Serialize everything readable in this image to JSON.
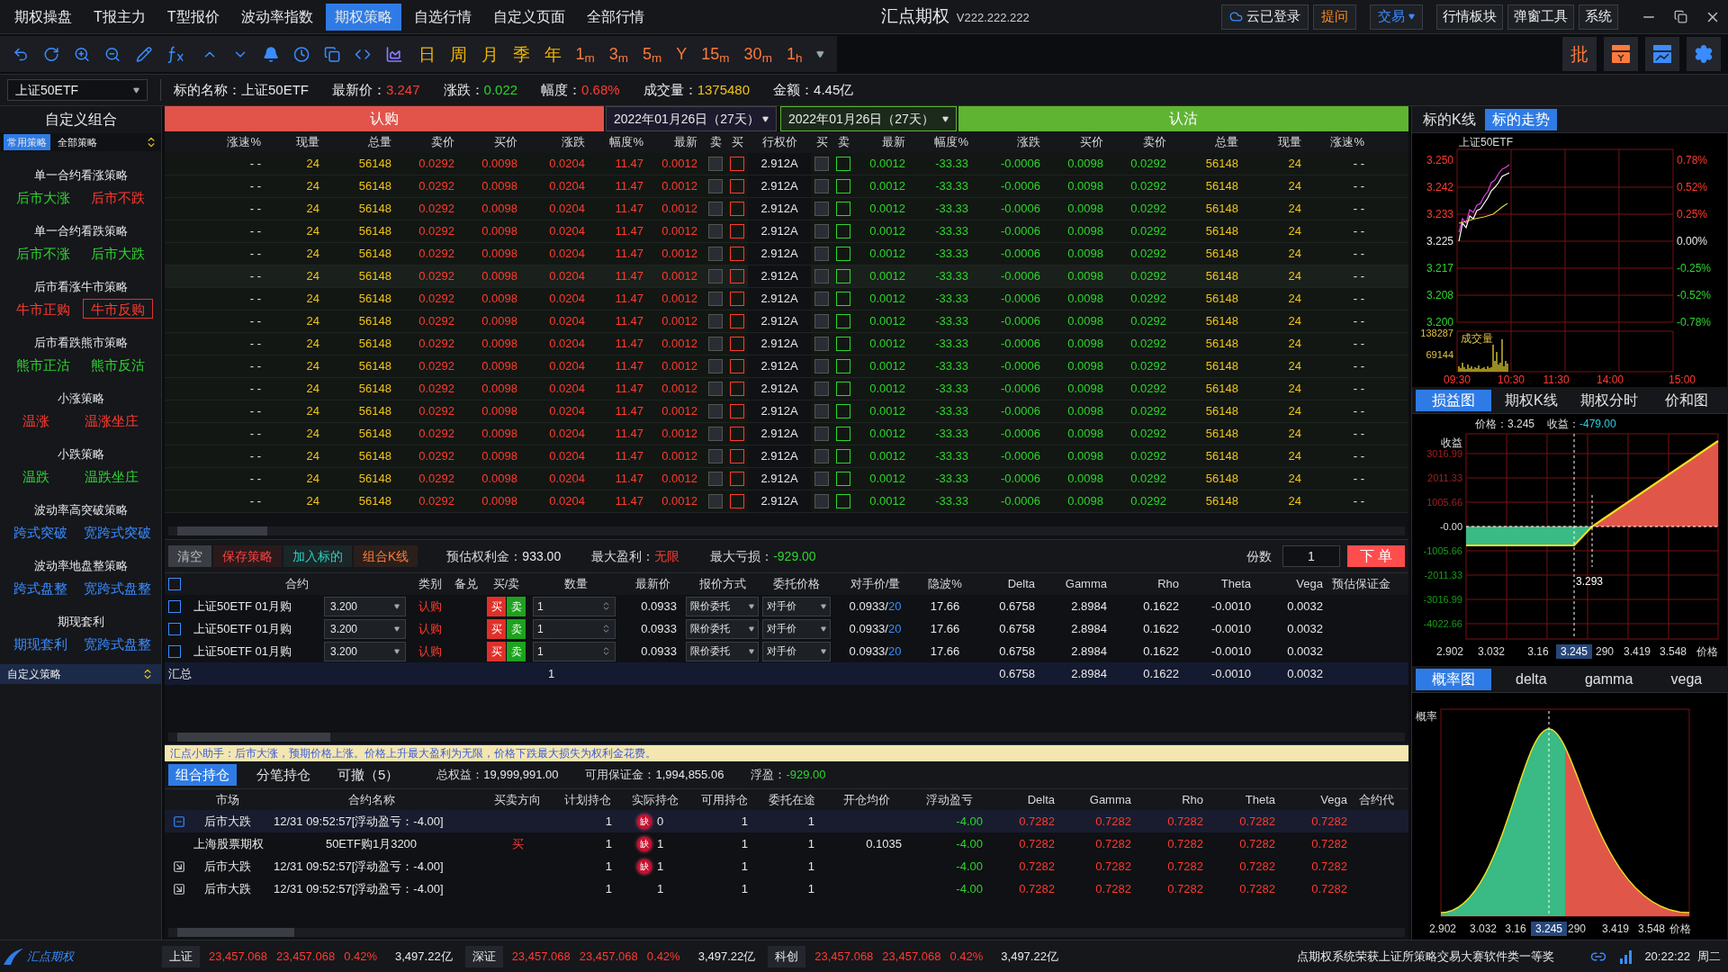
{
  "menu": {
    "tabs": [
      {
        "label": "期权操盘",
        "selected": false
      },
      {
        "label": "T报主力",
        "selected": false
      },
      {
        "label": "T型报价",
        "selected": false
      },
      {
        "label": "波动率指数",
        "selected": false
      },
      {
        "label": "期权策略",
        "selected": true
      },
      {
        "label": "自选行情",
        "selected": false
      },
      {
        "label": "自定义页面",
        "selected": false
      },
      {
        "label": "全部行情",
        "selected": false
      }
    ],
    "title": "汇点期权",
    "version": "V222.222.222",
    "buttons": [
      {
        "label": "云已登录",
        "kind": "cloud"
      },
      {
        "label": "提问",
        "kind": "ask"
      },
      {
        "label": "交易",
        "kind": "dropdown"
      },
      {
        "label": "行情板块",
        "kind": "plain"
      },
      {
        "label": "弹窗工具",
        "kind": "plain"
      },
      {
        "label": "系统",
        "kind": "plain"
      }
    ]
  },
  "toolbar": {
    "periods": [
      {
        "label": "日",
        "kind": "day"
      },
      {
        "label": "周",
        "kind": "day"
      },
      {
        "label": "月",
        "kind": "day"
      },
      {
        "label": "季",
        "kind": "day"
      },
      {
        "label": "年",
        "kind": "day"
      },
      {
        "label": "1$_{m}$",
        "kind": "minute"
      },
      {
        "label": "3$_{m}$",
        "kind": "minute"
      },
      {
        "label": "5$_{m}$",
        "kind": "minute"
      },
      {
        "label": "Y",
        "kind": "minute"
      },
      {
        "label": "15$_{m}$",
        "kind": "minute"
      },
      {
        "label": "30$_{m}$",
        "kind": "minute"
      },
      {
        "label": "1$_{h}$",
        "kind": "minute"
      }
    ],
    "batch": "批"
  },
  "info": {
    "symbol": "上证50ETF",
    "fields": [
      {
        "label": "标的名称：",
        "value": "上证50ETF",
        "color": "#e8e8e8"
      },
      {
        "label": "最新价：",
        "value": "3.247",
        "color": "#ff3b30"
      },
      {
        "label": "涨跌：",
        "value": "0.022",
        "color": "#2ed52e"
      },
      {
        "label": "幅度：",
        "value": "0.68%",
        "color": "#ff3b30"
      },
      {
        "label": "成交量：",
        "value": "1375480",
        "color": "#f0c419"
      },
      {
        "label": "金额：",
        "value": "4.45亿",
        "color": "#e8e8e8"
      }
    ]
  },
  "sidebar": {
    "title": "自定义组合",
    "tabs": [
      {
        "label": "常用策略",
        "selected": true
      },
      {
        "label": "全部策略",
        "selected": false
      }
    ],
    "groups": [
      {
        "title": "单一合约看涨策略",
        "items": [
          {
            "label": "后市大涨",
            "color": "#2ed52e",
            "selected": false
          },
          {
            "label": "后市不跌",
            "color": "#ff3b30",
            "selected": false
          }
        ]
      },
      {
        "title": "单一合约看跌策略",
        "items": [
          {
            "label": "后市不涨",
            "color": "#2ed52e",
            "selected": false
          },
          {
            "label": "后市大跌",
            "color": "#2ed52e",
            "selected": false
          }
        ]
      },
      {
        "title": "后市看涨牛市策略",
        "items": [
          {
            "label": "牛市正购",
            "color": "#ff3b30",
            "selected": false
          },
          {
            "label": "牛市反购",
            "color": "#ff3b30",
            "selected": true
          }
        ]
      },
      {
        "title": "后市看跌熊市策略",
        "items": [
          {
            "label": "熊市正沽",
            "color": "#2ed52e",
            "selected": false
          },
          {
            "label": "熊市反沽",
            "color": "#2ed52e",
            "selected": false
          }
        ]
      },
      {
        "title": "小涨策略",
        "items": [
          {
            "label": "温涨",
            "color": "#ff3b30",
            "selected": false
          },
          {
            "label": "温涨坐庄",
            "color": "#ff3b30",
            "selected": false
          }
        ]
      },
      {
        "title": "小跌策略",
        "items": [
          {
            "label": "温跌",
            "color": "#2ed52e",
            "selected": false
          },
          {
            "label": "温跌坐庄",
            "color": "#2ed52e",
            "selected": false
          }
        ]
      },
      {
        "title": "波动率高突破策略",
        "items": [
          {
            "label": "跨式突破",
            "color": "#3b8cff",
            "selected": false
          },
          {
            "label": "宽跨式突破",
            "color": "#3b8cff",
            "selected": false
          }
        ]
      },
      {
        "title": "波动率地盘整策略",
        "items": [
          {
            "label": "跨式盘整",
            "color": "#3b8cff",
            "selected": false
          },
          {
            "label": "宽跨式盘整",
            "color": "#3b8cff",
            "selected": false
          }
        ]
      },
      {
        "title": "期现套利",
        "items": [
          {
            "label": "期现套利",
            "color": "#3b8cff",
            "selected": false
          },
          {
            "label": "宽跨式盘整",
            "color": "#3b8cff",
            "selected": false
          }
        ]
      }
    ],
    "custom": "自定义策略"
  },
  "chain": {
    "call_label": "认购",
    "put_label": "认沽",
    "call_date": "2022年01月26日（27天）",
    "put_date": "2022年01月26日（27天）",
    "columns": [
      "涨速%",
      "现量",
      "总量",
      "卖价",
      "买价",
      "涨跌",
      "幅度%",
      "最新",
      "卖",
      "买",
      "行权价",
      "买",
      "卖",
      "最新",
      "幅度%",
      "涨跌",
      "买价",
      "卖价",
      "总量",
      "现量",
      "涨速%"
    ],
    "rows": [
      {
        "call": [
          "- -",
          "24",
          "56148",
          "0.0292",
          "0.0098",
          "0.0204",
          "11.47",
          "0.0012"
        ],
        "call_sell_checked": false,
        "call_buy_checked": false,
        "strike": "2.912A",
        "put_buy_checked": false,
        "put_sell_checked": false,
        "put": [
          "0.0012",
          "-33.33",
          "-0.0006",
          "0.0098",
          "0.0292",
          "56148",
          "24",
          "- -"
        ]
      },
      {
        "call": [
          "- -",
          "24",
          "56148",
          "0.0292",
          "0.0098",
          "0.0204",
          "11.47",
          "0.0012"
        ],
        "call_sell_checked": false,
        "call_buy_checked": false,
        "strike": "2.912A",
        "put_buy_checked": false,
        "put_sell_checked": false,
        "put": [
          "0.0012",
          "-33.33",
          "-0.0006",
          "0.0098",
          "0.0292",
          "56148",
          "24",
          "- -"
        ]
      },
      {
        "call": [
          "- -",
          "24",
          "56148",
          "0.0292",
          "0.0098",
          "0.0204",
          "11.47",
          "0.0012"
        ],
        "call_sell_checked": false,
        "call_buy_checked": false,
        "strike": "2.912A",
        "put_buy_checked": false,
        "put_sell_checked": false,
        "put": [
          "0.0012",
          "-33.33",
          "-0.0006",
          "0.0098",
          "0.0292",
          "56148",
          "24",
          "- -"
        ]
      },
      {
        "call": [
          "- -",
          "24",
          "56148",
          "0.0292",
          "0.0098",
          "0.0204",
          "11.47",
          "0.0012"
        ],
        "call_sell_checked": false,
        "call_buy_checked": false,
        "strike": "2.912A",
        "put_buy_checked": false,
        "put_sell_checked": false,
        "put": [
          "0.0012",
          "-33.33",
          "-0.0006",
          "0.0098",
          "0.0292",
          "56148",
          "24",
          "- -"
        ]
      },
      {
        "call": [
          "- -",
          "24",
          "56148",
          "0.0292",
          "0.0098",
          "0.0204",
          "11.47",
          "0.0012"
        ],
        "call_sell_checked": false,
        "call_buy_checked": false,
        "strike": "2.912A",
        "put_buy_checked": false,
        "put_sell_checked": false,
        "put": [
          "0.0012",
          "-33.33",
          "-0.0006",
          "0.0098",
          "0.0292",
          "56148",
          "24",
          "- -"
        ]
      },
      {
        "call": [
          "- -",
          "24",
          "56148",
          "0.0292",
          "0.0098",
          "0.0204",
          "11.47",
          "0.0012"
        ],
        "call_sell_checked": false,
        "call_buy_checked": false,
        "strike": "2.912A",
        "put_buy_checked": false,
        "put_sell_checked": false,
        "put": [
          "0.0012",
          "-33.33",
          "-0.0006",
          "0.0098",
          "0.0292",
          "56148",
          "24",
          "- -"
        ]
      },
      {
        "call": [
          "- -",
          "24",
          "56148",
          "0.0292",
          "0.0098",
          "0.0204",
          "11.47",
          "0.0012"
        ],
        "call_sell_checked": false,
        "call_buy_checked": false,
        "strike": "2.912A",
        "put_buy_checked": false,
        "put_sell_checked": false,
        "put": [
          "0.0012",
          "-33.33",
          "-0.0006",
          "0.0098",
          "0.0292",
          "56148",
          "24",
          "- -"
        ]
      },
      {
        "call": [
          "- -",
          "24",
          "56148",
          "0.0292",
          "0.0098",
          "0.0204",
          "11.47",
          "0.0012"
        ],
        "call_sell_checked": false,
        "call_buy_checked": false,
        "strike": "2.912A",
        "put_buy_checked": false,
        "put_sell_checked": false,
        "put": [
          "0.0012",
          "-33.33",
          "-0.0006",
          "0.0098",
          "0.0292",
          "56148",
          "24",
          "- -"
        ]
      },
      {
        "call": [
          "- -",
          "24",
          "56148",
          "0.0292",
          "0.0098",
          "0.0204",
          "11.47",
          "0.0012"
        ],
        "call_sell_checked": false,
        "call_buy_checked": false,
        "strike": "2.912A",
        "put_buy_checked": false,
        "put_sell_checked": false,
        "put": [
          "0.0012",
          "-33.33",
          "-0.0006",
          "0.0098",
          "0.0292",
          "56148",
          "24",
          "- -"
        ]
      },
      {
        "call": [
          "- -",
          "24",
          "56148",
          "0.0292",
          "0.0098",
          "0.0204",
          "11.47",
          "0.0012"
        ],
        "call_sell_checked": false,
        "call_buy_checked": false,
        "strike": "2.912A",
        "put_buy_checked": false,
        "put_sell_checked": false,
        "put": [
          "0.0012",
          "-33.33",
          "-0.0006",
          "0.0098",
          "0.0292",
          "56148",
          "24",
          "- -"
        ]
      },
      {
        "call": [
          "- -",
          "24",
          "56148",
          "0.0292",
          "0.0098",
          "0.0204",
          "11.47",
          "0.0012"
        ],
        "call_sell_checked": false,
        "call_buy_checked": false,
        "strike": "2.912A",
        "put_buy_checked": false,
        "put_sell_checked": false,
        "put": [
          "0.0012",
          "-33.33",
          "-0.0006",
          "0.0098",
          "0.0292",
          "56148",
          "24",
          "- -"
        ]
      },
      {
        "call": [
          "- -",
          "24",
          "56148",
          "0.0292",
          "0.0098",
          "0.0204",
          "11.47",
          "0.0012"
        ],
        "call_sell_checked": false,
        "call_buy_checked": false,
        "strike": "2.912A",
        "put_buy_checked": false,
        "put_sell_checked": false,
        "put": [
          "0.0012",
          "-33.33",
          "-0.0006",
          "0.0098",
          "0.0292",
          "56148",
          "24",
          "- -"
        ]
      },
      {
        "call": [
          "- -",
          "24",
          "56148",
          "0.0292",
          "0.0098",
          "0.0204",
          "11.47",
          "0.0012"
        ],
        "call_sell_checked": false,
        "call_buy_checked": false,
        "strike": "2.912A",
        "put_buy_checked": false,
        "put_sell_checked": false,
        "put": [
          "0.0012",
          "-33.33",
          "-0.0006",
          "0.0098",
          "0.0292",
          "56148",
          "24",
          "- -"
        ]
      },
      {
        "call": [
          "- -",
          "24",
          "56148",
          "0.0292",
          "0.0098",
          "0.0204",
          "11.47",
          "0.0012"
        ],
        "call_sell_checked": false,
        "call_buy_checked": false,
        "strike": "2.912A",
        "put_buy_checked": false,
        "put_sell_checked": false,
        "put": [
          "0.0012",
          "-33.33",
          "-0.0006",
          "0.0098",
          "0.0292",
          "56148",
          "24",
          "- -"
        ]
      },
      {
        "call": [
          "- -",
          "24",
          "56148",
          "0.0292",
          "0.0098",
          "0.0204",
          "11.47",
          "0.0012"
        ],
        "call_sell_checked": false,
        "call_buy_checked": false,
        "strike": "2.912A",
        "put_buy_checked": false,
        "put_sell_checked": false,
        "put": [
          "0.0012",
          "-33.33",
          "-0.0006",
          "0.0098",
          "0.0292",
          "56148",
          "24",
          "- -"
        ]
      },
      {
        "call": [
          "- -",
          "24",
          "56148",
          "0.0292",
          "0.0098",
          "0.0204",
          "11.47",
          "0.0012"
        ],
        "call_sell_checked": false,
        "call_buy_checked": false,
        "strike": "2.912A",
        "put_buy_checked": false,
        "put_sell_checked": false,
        "put": [
          "0.0012",
          "-33.33",
          "-0.0006",
          "0.0098",
          "0.0292",
          "56148",
          "24",
          "- -"
        ]
      }
    ]
  },
  "strategy": {
    "buttons": [
      "清空",
      "保存策略",
      "加入标的",
      "组合K线"
    ],
    "stats": [
      {
        "label": "预估权利金：",
        "value": "933.00",
        "color": "#e8e8e8"
      },
      {
        "label": "最大盈利：",
        "value": "无限",
        "color": "#ff3b30"
      },
      {
        "label": "最大亏损：",
        "value": "-929.00",
        "color": "#2ed52e"
      }
    ],
    "lots_label": "份数",
    "lots": "1",
    "order": "下 单",
    "all_checked": false,
    "columns": [
      "合约",
      "类别",
      "备兑",
      "买/卖",
      "数量",
      "最新价",
      "报价方式",
      "委托价格",
      "对手价/量",
      "隐波%",
      "Delta",
      "Gamma",
      "Rho",
      "Theta",
      "Vega",
      "预估保证金"
    ],
    "rows": [
      {
        "checked": false,
        "contract": "上证50ETF 01月购",
        "strike": "3.200",
        "type": "认购",
        "buy": "买",
        "sell": "卖",
        "qty": "1",
        "last": "0.0933",
        "order_type": "限价委托",
        "price_type": "对手价",
        "counter_price": "0.0933/",
        "counter_qty": "20",
        "iv": "17.66",
        "greeks": [
          "0.6758",
          "2.8984",
          "0.1622",
          "-0.0010",
          "0.0032"
        ]
      },
      {
        "checked": false,
        "contract": "上证50ETF 01月购",
        "strike": "3.200",
        "type": "认购",
        "buy": "买",
        "sell": "卖",
        "qty": "1",
        "last": "0.0933",
        "order_type": "限价委托",
        "price_type": "对手价",
        "counter_price": "0.0933/",
        "counter_qty": "20",
        "iv": "17.66",
        "greeks": [
          "0.6758",
          "2.8984",
          "0.1622",
          "-0.0010",
          "0.0032"
        ]
      },
      {
        "checked": false,
        "contract": "上证50ETF 01月购",
        "strike": "3.200",
        "type": "认购",
        "buy": "买",
        "sell": "卖",
        "qty": "1",
        "last": "0.0933",
        "order_type": "限价委托",
        "price_type": "对手价",
        "counter_price": "0.0933/",
        "counter_qty": "20",
        "iv": "17.66",
        "greeks": [
          "0.6758",
          "2.8984",
          "0.1622",
          "-0.0010",
          "0.0032"
        ]
      }
    ],
    "summary": {
      "label": "汇总",
      "qty": "1",
      "greeks": [
        "0.6758",
        "2.8984",
        "0.1622",
        "-0.0010",
        "0.0032"
      ]
    },
    "assistant": "汇点小助手：后市大涨，预期价格上涨。价格上升最大盈利为无限，价格下跌最大损失为权利金花费。"
  },
  "positions": {
    "tabs": [
      {
        "label": "组合持仓",
        "selected": true
      },
      {
        "label": "分笔持仓",
        "selected": false
      },
      {
        "label": "可撤（5）",
        "selected": false
      }
    ],
    "stats": [
      {
        "label": "总权益：",
        "value": "19,999,991.00",
        "color": "#e8e8e8"
      },
      {
        "label": "可用保证金：",
        "value": "1,994,855.06",
        "color": "#e8e8e8"
      },
      {
        "label": "浮盈：",
        "value": "-929.00",
        "color": "#2ed52e"
      }
    ],
    "columns": [
      "市场",
      "合约名称",
      "买卖方向",
      "计划持仓",
      "实际持仓",
      "可用持仓",
      "委托在途",
      "开仓均价",
      "浮动盈亏",
      "Delta",
      "Gamma",
      "Rho",
      "Theta",
      "Vega",
      "合约代"
    ],
    "rows": [
      {
        "kind": "group-open",
        "selected": true,
        "market": "后市大跌",
        "name": "12/31 09:52:57[浮动盈亏：-4.00]",
        "side": "",
        "plan": "1",
        "badge": "缺",
        "actual": "0",
        "available": "1",
        "pending": "1",
        "avg": "",
        "pnl": "-4.00",
        "greeks": [
          "0.7282",
          "0.7282",
          "0.7282",
          "0.7282",
          "0.7282"
        ]
      },
      {
        "kind": "leg",
        "selected": false,
        "market": "上海股票期权",
        "name": "50ETF购1月3200",
        "side": "买",
        "plan": "1",
        "badge": "缺",
        "actual": "1",
        "available": "1",
        "pending": "1",
        "avg": "0.1035",
        "pnl": "-4.00",
        "greeks": [
          "0.7282",
          "0.7282",
          "0.7282",
          "0.7282",
          "0.7282"
        ]
      },
      {
        "kind": "group",
        "selected": false,
        "market": "后市大跌",
        "name": "12/31 09:52:57[浮动盈亏：-4.00]",
        "side": "",
        "plan": "1",
        "badge": "缺",
        "actual": "1",
        "available": "1",
        "pending": "1",
        "avg": "",
        "pnl": "-4.00",
        "greeks": [
          "0.7282",
          "0.7282",
          "0.7282",
          "0.7282",
          "0.7282"
        ]
      },
      {
        "kind": "group",
        "selected": false,
        "market": "后市大跌",
        "name": "12/31 09:52:57[浮动盈亏：-4.00]",
        "side": "",
        "plan": "1",
        "badge": "",
        "actual": "1",
        "available": "1",
        "pending": "1",
        "avg": "",
        "pnl": "-4.00",
        "greeks": [
          "0.7282",
          "0.7282",
          "0.7282",
          "0.7282",
          "0.7282"
        ]
      }
    ]
  },
  "trend": {
    "tabs": [
      {
        "label": "标的K线",
        "selected": false
      },
      {
        "label": "标的走势",
        "selected": true
      }
    ],
    "name": "上证50ETF",
    "left_ticks": [
      "3.250",
      "3.242",
      "3.233",
      "3.225",
      "3.217",
      "3.208",
      "3.200"
    ],
    "right_ticks": [
      "0.78%",
      "0.52%",
      "0.25%",
      "0.00%",
      "-0.25%",
      "-0.52%",
      "-0.78%"
    ],
    "volume_label": "成交量",
    "volume_ticks": [
      "138287",
      "69144"
    ],
    "time_ticks": [
      "09:30",
      "10:30",
      "11:30",
      "14:00",
      "15:00"
    ]
  },
  "payoff": {
    "tabs": [
      {
        "label": "损益图",
        "selected": true
      },
      {
        "label": "期权K线",
        "selected": false
      },
      {
        "label": "期权分时",
        "selected": false
      },
      {
        "label": "价和图",
        "selected": false
      }
    ],
    "price_label": "价格：3.245",
    "gain_label": "收益：",
    "gain": "-479.00",
    "ylabel": "收益",
    "yticks": [
      "3016.99",
      "2011.33",
      "1005.66",
      "-0.00",
      "-1005.66",
      "-2011.33",
      "-3016.99",
      "-4022.66"
    ],
    "xticks": [
      "2.902",
      "3.032",
      "3.16",
      "290",
      "3.419",
      "3.548"
    ],
    "xlabel": "价格",
    "cursor": "3.245",
    "breakeven": "3.293"
  },
  "probability": {
    "tabs": [
      {
        "label": "概率图",
        "selected": true
      },
      {
        "label": "delta",
        "selected": false
      },
      {
        "label": "gamma",
        "selected": false
      },
      {
        "label": "vega",
        "selected": false
      }
    ],
    "ylabel": "概率",
    "xticks": [
      "2.902",
      "3.032",
      "3.16",
      "290",
      "3.419",
      "3.548"
    ],
    "xlabel": "价格",
    "cursor": "3.245"
  },
  "status": {
    "logo": "汇点期权",
    "indices": [
      {
        "name": "上证",
        "values": [
          "23,457.068",
          "23,457.068",
          "0.42%",
          "3,497.22亿"
        ]
      },
      {
        "name": "深证",
        "values": [
          "23,457.068",
          "23,457.068",
          "0.42%",
          "3,497.22亿"
        ]
      },
      {
        "name": "科创",
        "values": [
          "23,457.068",
          "23,457.068",
          "0.42%",
          "3,497.22亿"
        ]
      }
    ],
    "news": "点期权系统荣获上证所策略交易大赛软件类一等奖",
    "time": "20:22:22",
    "weekday": "周二"
  }
}
